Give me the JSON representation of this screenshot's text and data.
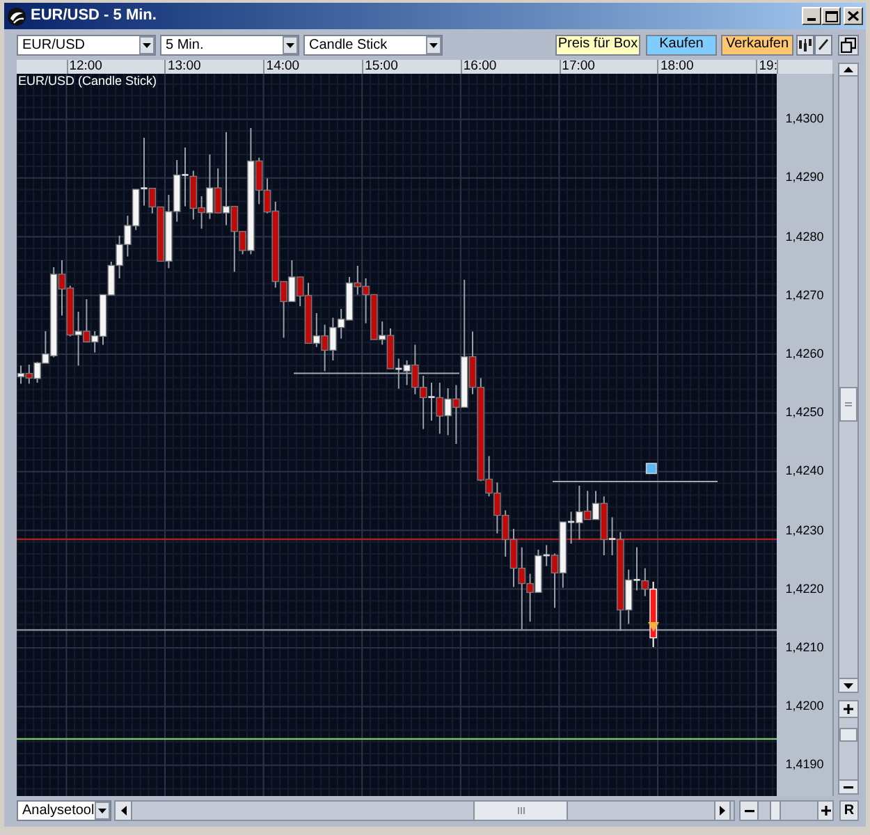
{
  "window": {
    "title": "EUR/USD - 5 Min."
  },
  "toolbar": {
    "dropdowns": [
      {
        "value": "EUR/USD"
      },
      {
        "value": "5 Min."
      },
      {
        "value": "Candle Stick"
      }
    ],
    "buttons": [
      {
        "label": "Preis für Box",
        "color": "#ffffc0"
      },
      {
        "label": "Kaufen",
        "color": "#80ccff"
      },
      {
        "label": "Verkaufen",
        "color": "#ffc66e"
      }
    ]
  },
  "time_axis": {
    "labels": [
      "12:00",
      "13:00",
      "14:00",
      "15:00",
      "16:00",
      "17:00",
      "18:00",
      "19:"
    ]
  },
  "chart": {
    "caption": "EUR/USD (Candle Stick)"
  },
  "price_axis": {
    "labels": [
      "1,4300",
      "1,4290",
      "1,4280",
      "1,4270",
      "1,4260",
      "1,4250",
      "1,4240",
      "1,4230",
      "1,4220",
      "1,4210",
      "1,4200",
      "1,4190"
    ]
  },
  "bottom_bar": {
    "tool_dropdown": {
      "value": "Analysetool"
    },
    "reset_button": {
      "label": "R"
    }
  }
}
